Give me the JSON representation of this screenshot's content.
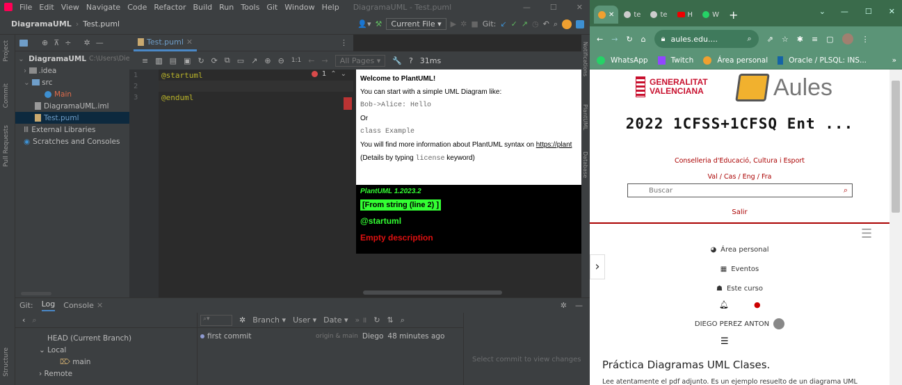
{
  "ide": {
    "menu": [
      "File",
      "Edit",
      "View",
      "Navigate",
      "Code",
      "Refactor",
      "Build",
      "Run",
      "Tools",
      "Git",
      "Window",
      "Help"
    ],
    "window_title": "DiagramaUML - Test.puml",
    "breadcrumb": {
      "project": "DiagramaUML",
      "file": "Test.puml"
    },
    "run_config": "Current File",
    "git_label": "Git:",
    "project_tree": {
      "root": "DiagramaUML",
      "root_path": "C:\\Users\\Diere",
      "items": [
        ".idea",
        "src",
        "Main",
        "DiagramaUML.iml",
        "Test.puml",
        "External Libraries",
        "Scratches and Consoles"
      ]
    },
    "left_strip": [
      "Project",
      "Commit",
      "Pull Requests",
      "Structure"
    ],
    "editor_tab": "Test.puml",
    "lines": [
      "1",
      "2",
      "3"
    ],
    "code": [
      "@startuml",
      "",
      "@enduml"
    ],
    "error_count": "1",
    "puml_toolbar": {
      "zoom": "1:1",
      "pages": "All Pages",
      "help": "?",
      "time": "31ms"
    },
    "preview": {
      "welcome": "Welcome to PlantUML!",
      "line1": "You can start with a simple UML Diagram like:",
      "code1": "Bob->Alice: Hello",
      "or": "Or",
      "code2": "class Example",
      "more": "You will find more information about PlantUML syntax on ",
      "link": "https://plant",
      "details_a": "(Details by typing ",
      "details_code": "license",
      "details_b": " keyword)",
      "version": "PlantUML 1.2023.2",
      "from_string": "[From string (line 2) ]",
      "startuml": "@startuml",
      "empty": "Empty description"
    },
    "right_strip": [
      "Notifications",
      "PlantUML",
      "Database"
    ],
    "bottom_tabs": {
      "git": "Git:",
      "log": "Log",
      "console": "Console"
    },
    "log_filters": [
      "Branch",
      "User",
      "Date"
    ],
    "branches": {
      "head": "HEAD (Current Branch)",
      "local": "Local",
      "main": "main",
      "remote": "Remote"
    },
    "commit": {
      "message": "first commit",
      "tags": "origin & main",
      "author": "Diego",
      "time": "48 minutes ago"
    },
    "select_hint": "Select commit to view changes"
  },
  "chrome": {
    "tabs": [
      "te",
      "te",
      "H",
      "W"
    ],
    "url": "aules.edu....",
    "bookmarks": [
      "WhatsApp",
      "Twitch",
      "Área personal",
      "Oracle / PLSQL: INS..."
    ],
    "page": {
      "logo_gv": "GENERALITAT\nVALENCIANA",
      "logo_aules": "Aules",
      "course": "2022 1CFSS+1CFSQ Ent ...",
      "conselleria": "Conselleria d'Educació, Cultura i Esport",
      "langs": "Val / Cas / Eng / Fra",
      "search_placeholder": "Buscar",
      "logout": "Salir",
      "nav": [
        "Área personal",
        "Eventos",
        "Este curso"
      ],
      "user": "DIEGO PEREZ ANTON",
      "heading": "Práctica Diagramas UML Clases.",
      "body": "Lee atentamente el pdf adjunto. Es un ejemplo resuelto de un diagrama UML"
    }
  }
}
